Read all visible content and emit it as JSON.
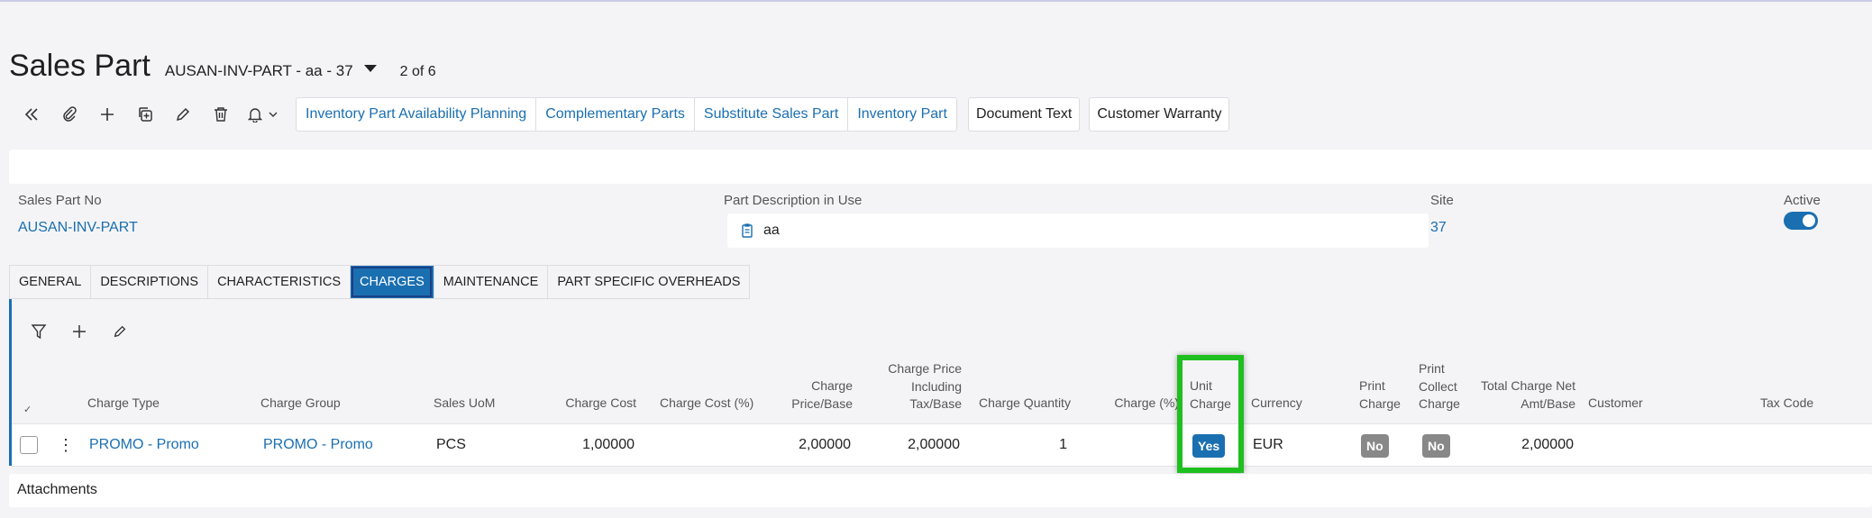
{
  "page": {
    "title": "Sales Part",
    "record": "AUSAN-INV-PART - aa - 37",
    "record_count": "2 of 6"
  },
  "toolbar": {
    "icons": [
      "collapse-icon",
      "attachment-icon",
      "add-icon",
      "duplicate-icon",
      "edit-icon",
      "delete-icon",
      "bell-icon"
    ],
    "links": [
      "Inventory Part Availability Planning",
      "Complementary Parts",
      "Substitute Sales Part",
      "Inventory Part"
    ],
    "document_text": "Document Text",
    "customer_warranty": "Customer Warranty"
  },
  "header": {
    "sales_part_no_label": "Sales Part No",
    "sales_part_no": "AUSAN-INV-PART",
    "description_label": "Part Description in Use",
    "description": "aa",
    "site_label": "Site",
    "site": "37",
    "active_label": "Active",
    "active": true
  },
  "tabs": [
    "GENERAL",
    "DESCRIPTIONS",
    "CHARACTERISTICS",
    "CHARGES",
    "MAINTENANCE",
    "PART SPECIFIC OVERHEADS"
  ],
  "active_tab": "CHARGES",
  "grid": {
    "columns": {
      "charge_type": "Charge Type",
      "charge_group": "Charge Group",
      "sales_uom": "Sales UoM",
      "charge_cost": "Charge Cost",
      "charge_cost_pct": "Charge Cost (%)",
      "charge_price": [
        "Charge",
        "Price/Base"
      ],
      "charge_price_incl": [
        "Charge Price",
        "Including",
        "Tax/Base"
      ],
      "charge_quantity": "Charge Quantity",
      "charge_pct": "Charge (%)",
      "unit_charge": [
        "Unit",
        "Charge"
      ],
      "currency": "Currency",
      "print_charge": [
        "Print",
        "Charge"
      ],
      "print_collect": [
        "Print",
        "Collect",
        "Charge"
      ],
      "total_charge": [
        "Total Charge Net",
        "Amt/Base"
      ],
      "customer": "Customer",
      "tax_code": "Tax Code"
    },
    "rows": [
      {
        "charge_type": "PROMO - Promo",
        "charge_group": "PROMO - Promo",
        "sales_uom": "PCS",
        "charge_cost": "1,00000",
        "charge_price": "2,00000",
        "charge_price_incl": "2,00000",
        "charge_quantity": "1",
        "unit_charge": "Yes",
        "currency": "EUR",
        "print_charge": "No",
        "print_collect": "No",
        "total_charge": "2,00000"
      }
    ]
  },
  "attachments_label": "Attachments",
  "colors": {
    "accent": "#1a6fb0",
    "highlight": "#1fbf1f"
  }
}
